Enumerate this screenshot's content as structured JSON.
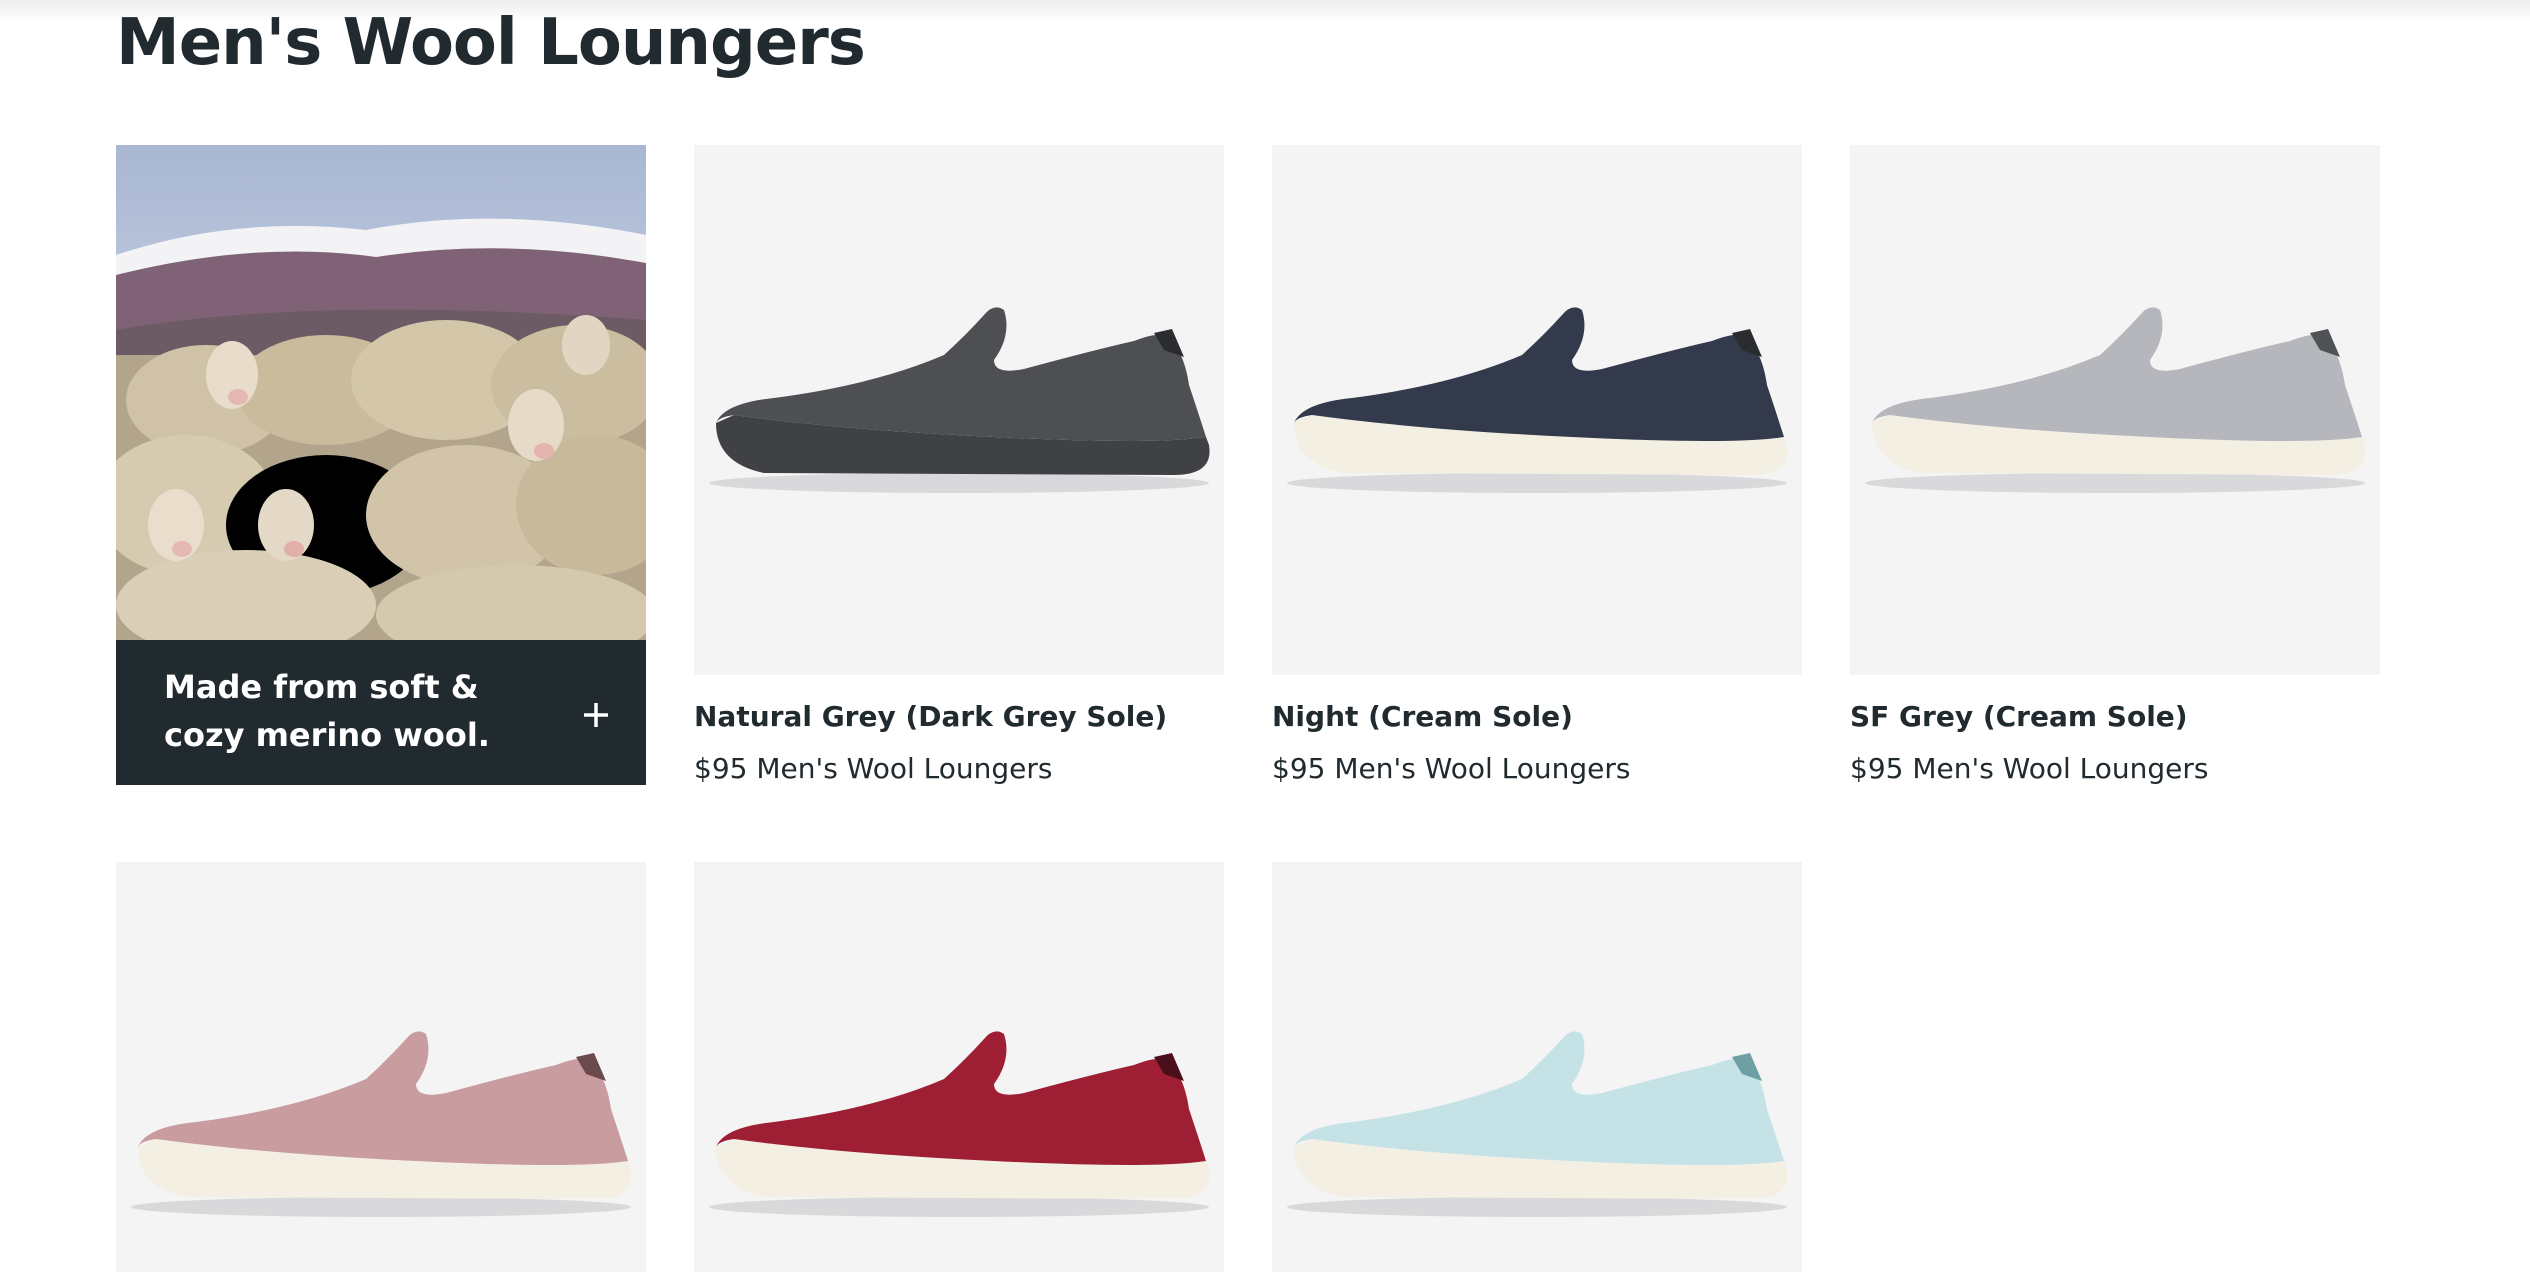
{
  "page": {
    "title": "Men's Wool Loungers"
  },
  "promo": {
    "text_line1": "Made from soft &",
    "text_line2": "cozy merino wool.",
    "expand_icon": "plus-icon"
  },
  "products": [
    {
      "name": "Natural Grey (Dark Grey Sole)",
      "price": "$95",
      "category": "Men's Wool Loungers",
      "upper_color": "#4d4f53",
      "sole_color": "#3f4145"
    },
    {
      "name": "Night (Cream Sole)",
      "price": "$95",
      "category": "Men's Wool Loungers",
      "upper_color": "#333a4c",
      "sole_color": "#f3efe3"
    },
    {
      "name": "SF Grey (Cream Sole)",
      "price": "$95",
      "category": "Men's Wool Loungers",
      "upper_color": "#b6b7bc",
      "sole_color": "#f3efe3"
    },
    {
      "upper_color": "#c99c9f",
      "sole_color": "#f3efe3"
    },
    {
      "upper_color": "#9e1f34",
      "sole_color": "#f3efe3"
    },
    {
      "upper_color": "#c5e3e6",
      "sole_color": "#f3efe3"
    }
  ],
  "colors": {
    "text": "#212a2f",
    "tile_bg": "#f4f4f5",
    "promo_bg": "#212a2f"
  }
}
